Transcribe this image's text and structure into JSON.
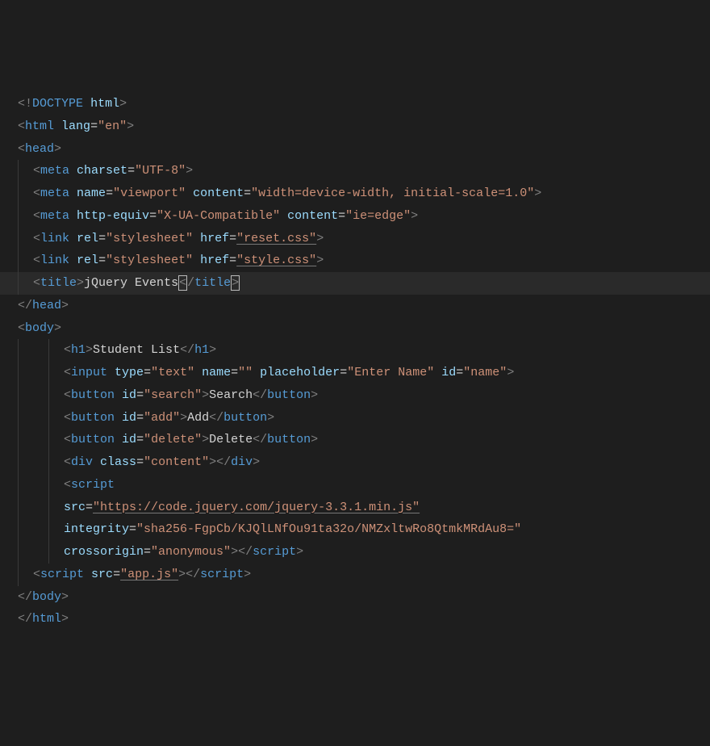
{
  "doctype": {
    "bang": "!",
    "name": "DOCTYPE",
    "arg": "html"
  },
  "htmlTag": "html",
  "lang": {
    "attr": "lang",
    "val": "\"en\""
  },
  "head": "head",
  "meta": "meta",
  "charsetAttr": "charset",
  "charsetVal": "\"UTF-8\"",
  "nameAttr": "name",
  "viewportVal": "\"viewport\"",
  "contentAttr": "content",
  "vpContentVal": "\"width=device-width, initial-scale=1.0\"",
  "httpEquivAttr": "http-equiv",
  "httpEquivVal": "\"X-UA-Compatible\"",
  "ieVal": "\"ie=edge\"",
  "link": "link",
  "relAttr": "rel",
  "relVal": "\"stylesheet\"",
  "hrefAttr": "href",
  "resetCss": "\"reset.css\"",
  "styleCss": "\"style.css\"",
  "titleTag": "title",
  "titleText": "jQuery Events",
  "body": "body",
  "h1": "h1",
  "h1Text": "Student List",
  "input": "input",
  "typeAttr": "type",
  "typeVal": "\"text\"",
  "nameVal": "\"\"",
  "placeholderAttr": "placeholder",
  "placeholderVal": "\"Enter Name\"",
  "idAttr": "id",
  "idName": "\"name\"",
  "button": "button",
  "idSearch": "\"search\"",
  "searchText": "Search",
  "idAdd": "\"add\"",
  "addText": "Add",
  "idDelete": "\"delete\"",
  "deleteText": "Delete",
  "div": "div",
  "classAttr": "class",
  "contentVal": "\"content\"",
  "script": "script",
  "srcAttr": "src",
  "jqueryUrl": "\"https://code.jquery.com/jquery-3.3.1.min.js\"",
  "integrityAttr": "integrity",
  "integrityVal": "\"sha256-FgpCb/KJQlLNfOu91ta32o/NMZxltwRo8QtmkMRdAu8=\"",
  "crossAttr": "crossorigin",
  "crossVal": "\"anonymous\"",
  "appJs": "\"app.js\""
}
